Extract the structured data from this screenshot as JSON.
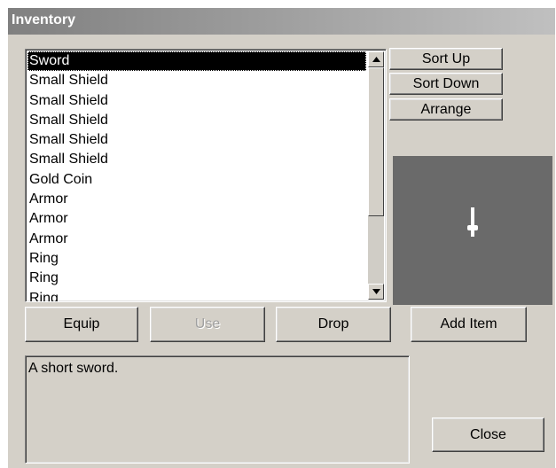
{
  "window": {
    "title": "Inventory"
  },
  "inventory": {
    "items": [
      "Sword",
      "Small Shield",
      "Small Shield",
      "Small Shield",
      "Small Shield",
      "Small Shield",
      "Gold Coin",
      "Armor",
      "Armor",
      "Armor",
      "Ring",
      "Ring",
      "Ring"
    ],
    "selected_index": 0,
    "scroll": {
      "up_icon": "arrow-up-icon",
      "down_icon": "arrow-down-icon"
    }
  },
  "sort_buttons": {
    "sort_up": "Sort Up",
    "sort_down": "Sort Down",
    "arrange": "Arrange"
  },
  "preview": {
    "icon": "short-sword-icon",
    "background": "#6a6a6a"
  },
  "actions": {
    "equip": "Equip",
    "use": "Use",
    "drop": "Drop",
    "add_item": "Add Item",
    "close": "Close"
  },
  "description": {
    "text": "A short sword."
  }
}
